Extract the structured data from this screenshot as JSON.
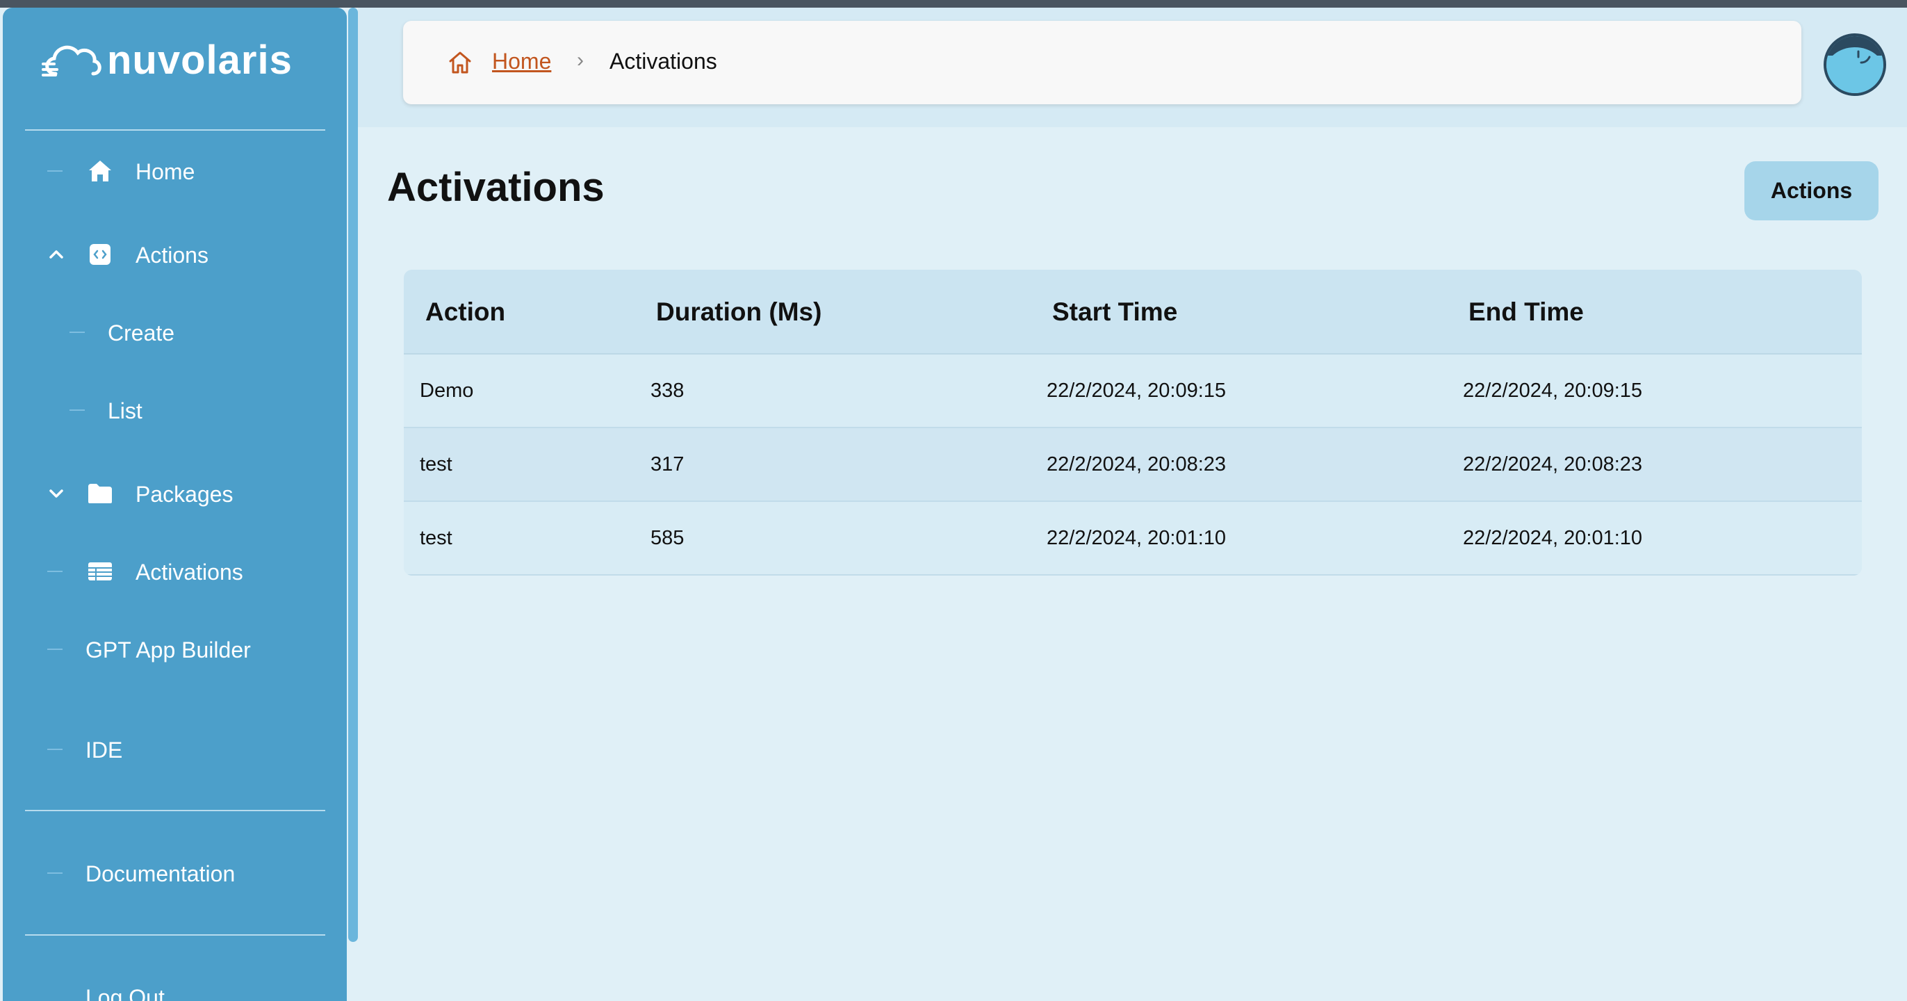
{
  "brand": {
    "name": "nuvolaris"
  },
  "sidebar": {
    "items": [
      {
        "label": "Home"
      },
      {
        "label": "Actions"
      },
      {
        "label": "Create"
      },
      {
        "label": "List"
      },
      {
        "label": "Packages"
      },
      {
        "label": "Activations"
      },
      {
        "label": "GPT App Builder"
      },
      {
        "label": "IDE"
      },
      {
        "label": "Documentation"
      },
      {
        "label": "Log Out"
      }
    ]
  },
  "breadcrumb": {
    "home": "Home",
    "separator": "›",
    "current": "Activations"
  },
  "page": {
    "title": "Activations",
    "actions_button": "Actions"
  },
  "table": {
    "headers": [
      "Action",
      "Duration (Ms)",
      "Start Time",
      "End Time"
    ],
    "rows": [
      [
        "Demo",
        "338",
        "22/2/2024, 20:09:15",
        "22/2/2024, 20:09:15"
      ],
      [
        "test",
        "317",
        "22/2/2024, 20:08:23",
        "22/2/2024, 20:08:23"
      ],
      [
        "test",
        "585",
        "22/2/2024, 20:01:10",
        "22/2/2024, 20:01:10"
      ]
    ]
  },
  "colors": {
    "sidebar": "#4c9fca",
    "accent_link": "#c2561f",
    "page_bg": "#e0f0f7"
  }
}
